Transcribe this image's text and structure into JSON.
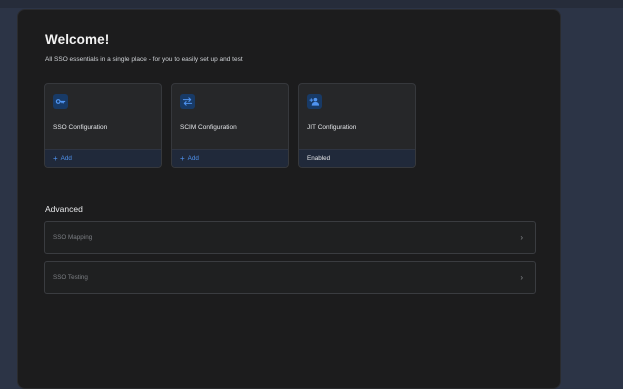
{
  "welcome": {
    "title": "Welcome!",
    "subtitle": "All SSO essentials in a single place - for you to easily set up and test"
  },
  "cards": [
    {
      "title": "SSO Configuration",
      "footer": "Add",
      "footer_type": "add",
      "icon": "key-icon"
    },
    {
      "title": "SCIM Configuration",
      "footer": "Add",
      "footer_type": "add",
      "icon": "arrows-swap-icon"
    },
    {
      "title": "JIT Configuration",
      "footer": "Enabled",
      "footer_type": "status",
      "icon": "person-add-icon"
    }
  ],
  "advanced": {
    "title": "Advanced",
    "items": [
      {
        "label": "SSO Mapping"
      },
      {
        "label": "SSO Testing"
      }
    ]
  },
  "colors": {
    "accent": "#4f93f0",
    "icon_bg": "#183a66",
    "panel_bg": "#1c1c1d",
    "page_bg": "#2c3446"
  }
}
